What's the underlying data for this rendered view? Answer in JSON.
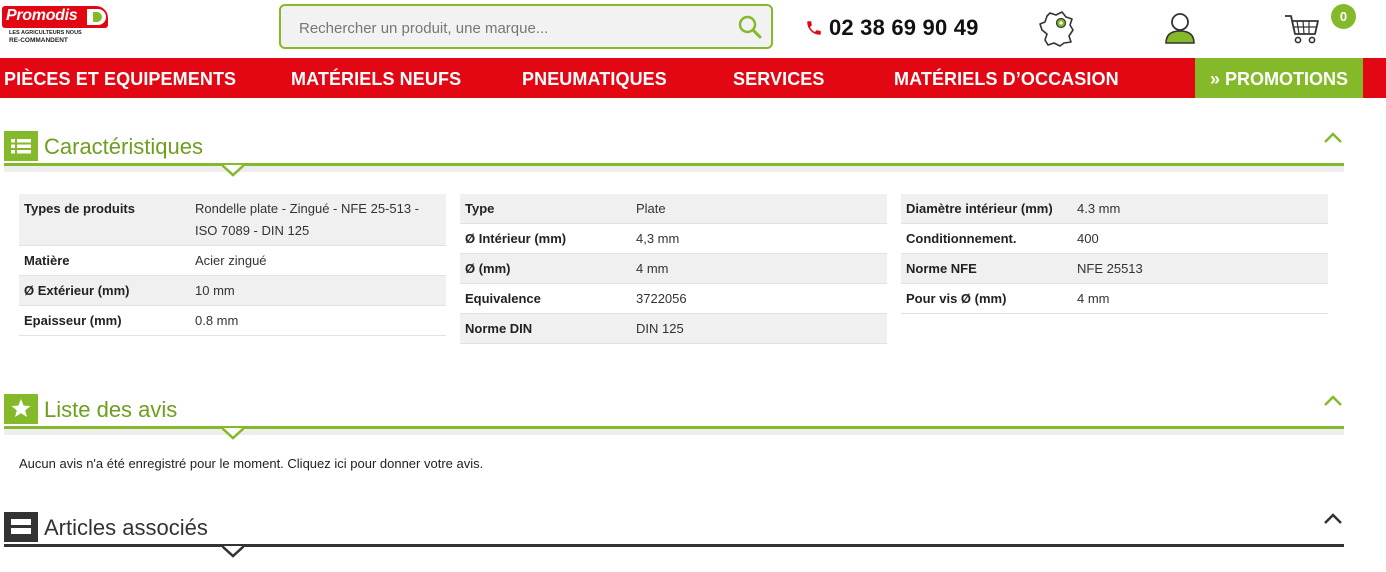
{
  "header": {
    "logo": {
      "brand": "Promodis",
      "tagline_1": "LES AGRICULTEURS NOUS",
      "tagline_2": "RE-COMMANDENT"
    },
    "search": {
      "placeholder": "Rechercher un produit, une marque...",
      "value": ""
    },
    "phone": "02 38 69 90 49",
    "cart_count": "0"
  },
  "nav": {
    "items": [
      {
        "label": "PIÈCES ET EQUIPEMENTS"
      },
      {
        "label": "MATÉRIELS NEUFS"
      },
      {
        "label": "PNEUMATIQUES"
      },
      {
        "label": "SERVICES"
      },
      {
        "label": "MATÉRIELS D’OCCASION"
      }
    ],
    "promo": "» PROMOTIONS"
  },
  "sections": {
    "caracteristiques": {
      "title": "Caractéristiques"
    },
    "avis": {
      "title": "Liste des avis",
      "empty_text": "Aucun avis n'a été enregistré pour le moment. Cliquez ici pour donner votre avis."
    },
    "associes": {
      "title": "Articles associés"
    }
  },
  "specs": {
    "col1": [
      {
        "label": "Types de produits",
        "value": "Rondelle plate - Zingué - NFE 25-513 - ISO 7089 - DIN 125"
      },
      {
        "label": "Matière",
        "value": "Acier zingué"
      },
      {
        "label": "Ø Extérieur (mm)",
        "value": "10 mm"
      },
      {
        "label": "Epaisseur (mm)",
        "value": "0.8 mm"
      }
    ],
    "col2": [
      {
        "label": "Type",
        "value": "Plate"
      },
      {
        "label": "Ø Intérieur (mm)",
        "value": "4,3 mm"
      },
      {
        "label": "Ø (mm)",
        "value": "4 mm"
      },
      {
        "label": "Equivalence",
        "value": "3722056"
      },
      {
        "label": "Norme DIN",
        "value": "DIN 125"
      }
    ],
    "col3": [
      {
        "label": "Diamètre intérieur (mm)",
        "value": "4.3 mm"
      },
      {
        "label": "Conditionnement.",
        "value": "400"
      },
      {
        "label": "Norme NFE",
        "value": "NFE 25513"
      },
      {
        "label": "Pour vis Ø (mm)",
        "value": "4 mm"
      }
    ]
  },
  "colors": {
    "brand_red": "#e30613",
    "accent_green": "#84b92a",
    "title_green": "#6e9e1f"
  }
}
